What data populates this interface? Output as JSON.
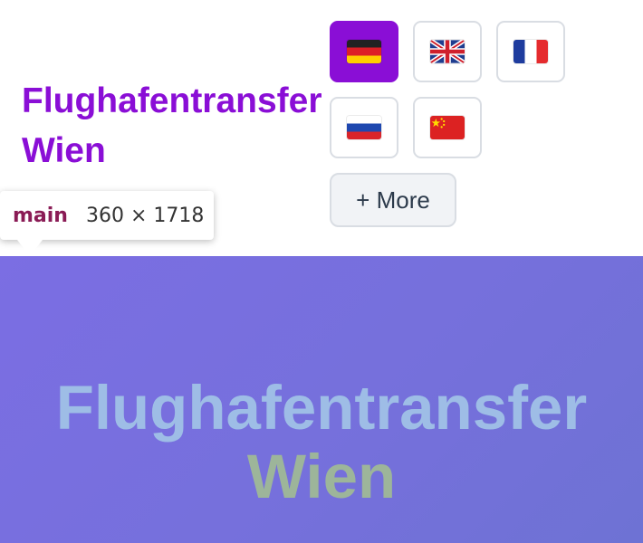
{
  "header": {
    "title_line1": "Flughafentransfer",
    "title_line2": "Wien",
    "title_color": "#8a0ed6"
  },
  "languages": [
    {
      "code": "de",
      "icon": "flag-germany-icon",
      "active": true
    },
    {
      "code": "en",
      "icon": "flag-uk-icon",
      "active": false
    },
    {
      "code": "fr",
      "icon": "flag-france-icon",
      "active": false
    },
    {
      "code": "ru",
      "icon": "flag-russia-icon",
      "active": false
    },
    {
      "code": "zh",
      "icon": "flag-china-icon",
      "active": false
    }
  ],
  "more_button": {
    "label": "+ More"
  },
  "inspector": {
    "tag": "main",
    "size": "360 × 1718"
  },
  "hero": {
    "title_line1": "Flughafentransfer",
    "title_line2": "Wien",
    "background_color": "#7670dd",
    "line1_color": "#9ebde6",
    "line2_color": "#9db59a"
  }
}
